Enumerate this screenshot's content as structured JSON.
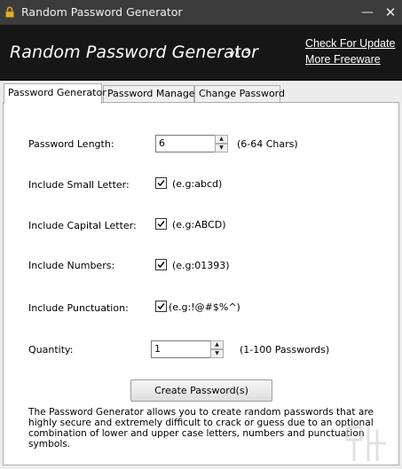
{
  "window": {
    "title": "Random Password Generator"
  },
  "banner": {
    "title": "Random Password Generator",
    "version": "v1.3",
    "link_update": "Check For Update",
    "link_more": "More Freeware"
  },
  "tabs": [
    {
      "label": "Password Generator",
      "active": true
    },
    {
      "label": "Password Manager",
      "active": false
    },
    {
      "label": "Change Password",
      "active": false
    }
  ],
  "form": {
    "length_label": "Password Length:",
    "length_value": "6",
    "length_hint": "(6-64 Chars)",
    "small_label": "Include Small Letter:",
    "small_checked": true,
    "small_hint": "(e.g:abcd)",
    "capital_label": "Include Capital Letter:",
    "capital_checked": true,
    "capital_hint": "(e.g:ABCD)",
    "numbers_label": "Include Numbers:",
    "numbers_checked": true,
    "numbers_hint": "(e.g:01393)",
    "punct_label": "Include Punctuation:",
    "punct_checked": true,
    "punct_hint": "(e.g:!@#$%^)",
    "quantity_label": "Quantity:",
    "quantity_value": "1",
    "quantity_hint": "(1-100 Passwords)",
    "create_label": "Create Password(s)"
  },
  "description": "The Password Generator allows you to create random passwords that are highly secure and extremely difficult to crack or guess due to an optional combination of lower and upper case letters, numbers and punctuation symbols.",
  "colors": {
    "titlebar": "#3b3b3b",
    "banner": "#161616",
    "panel": "#ffffff"
  }
}
